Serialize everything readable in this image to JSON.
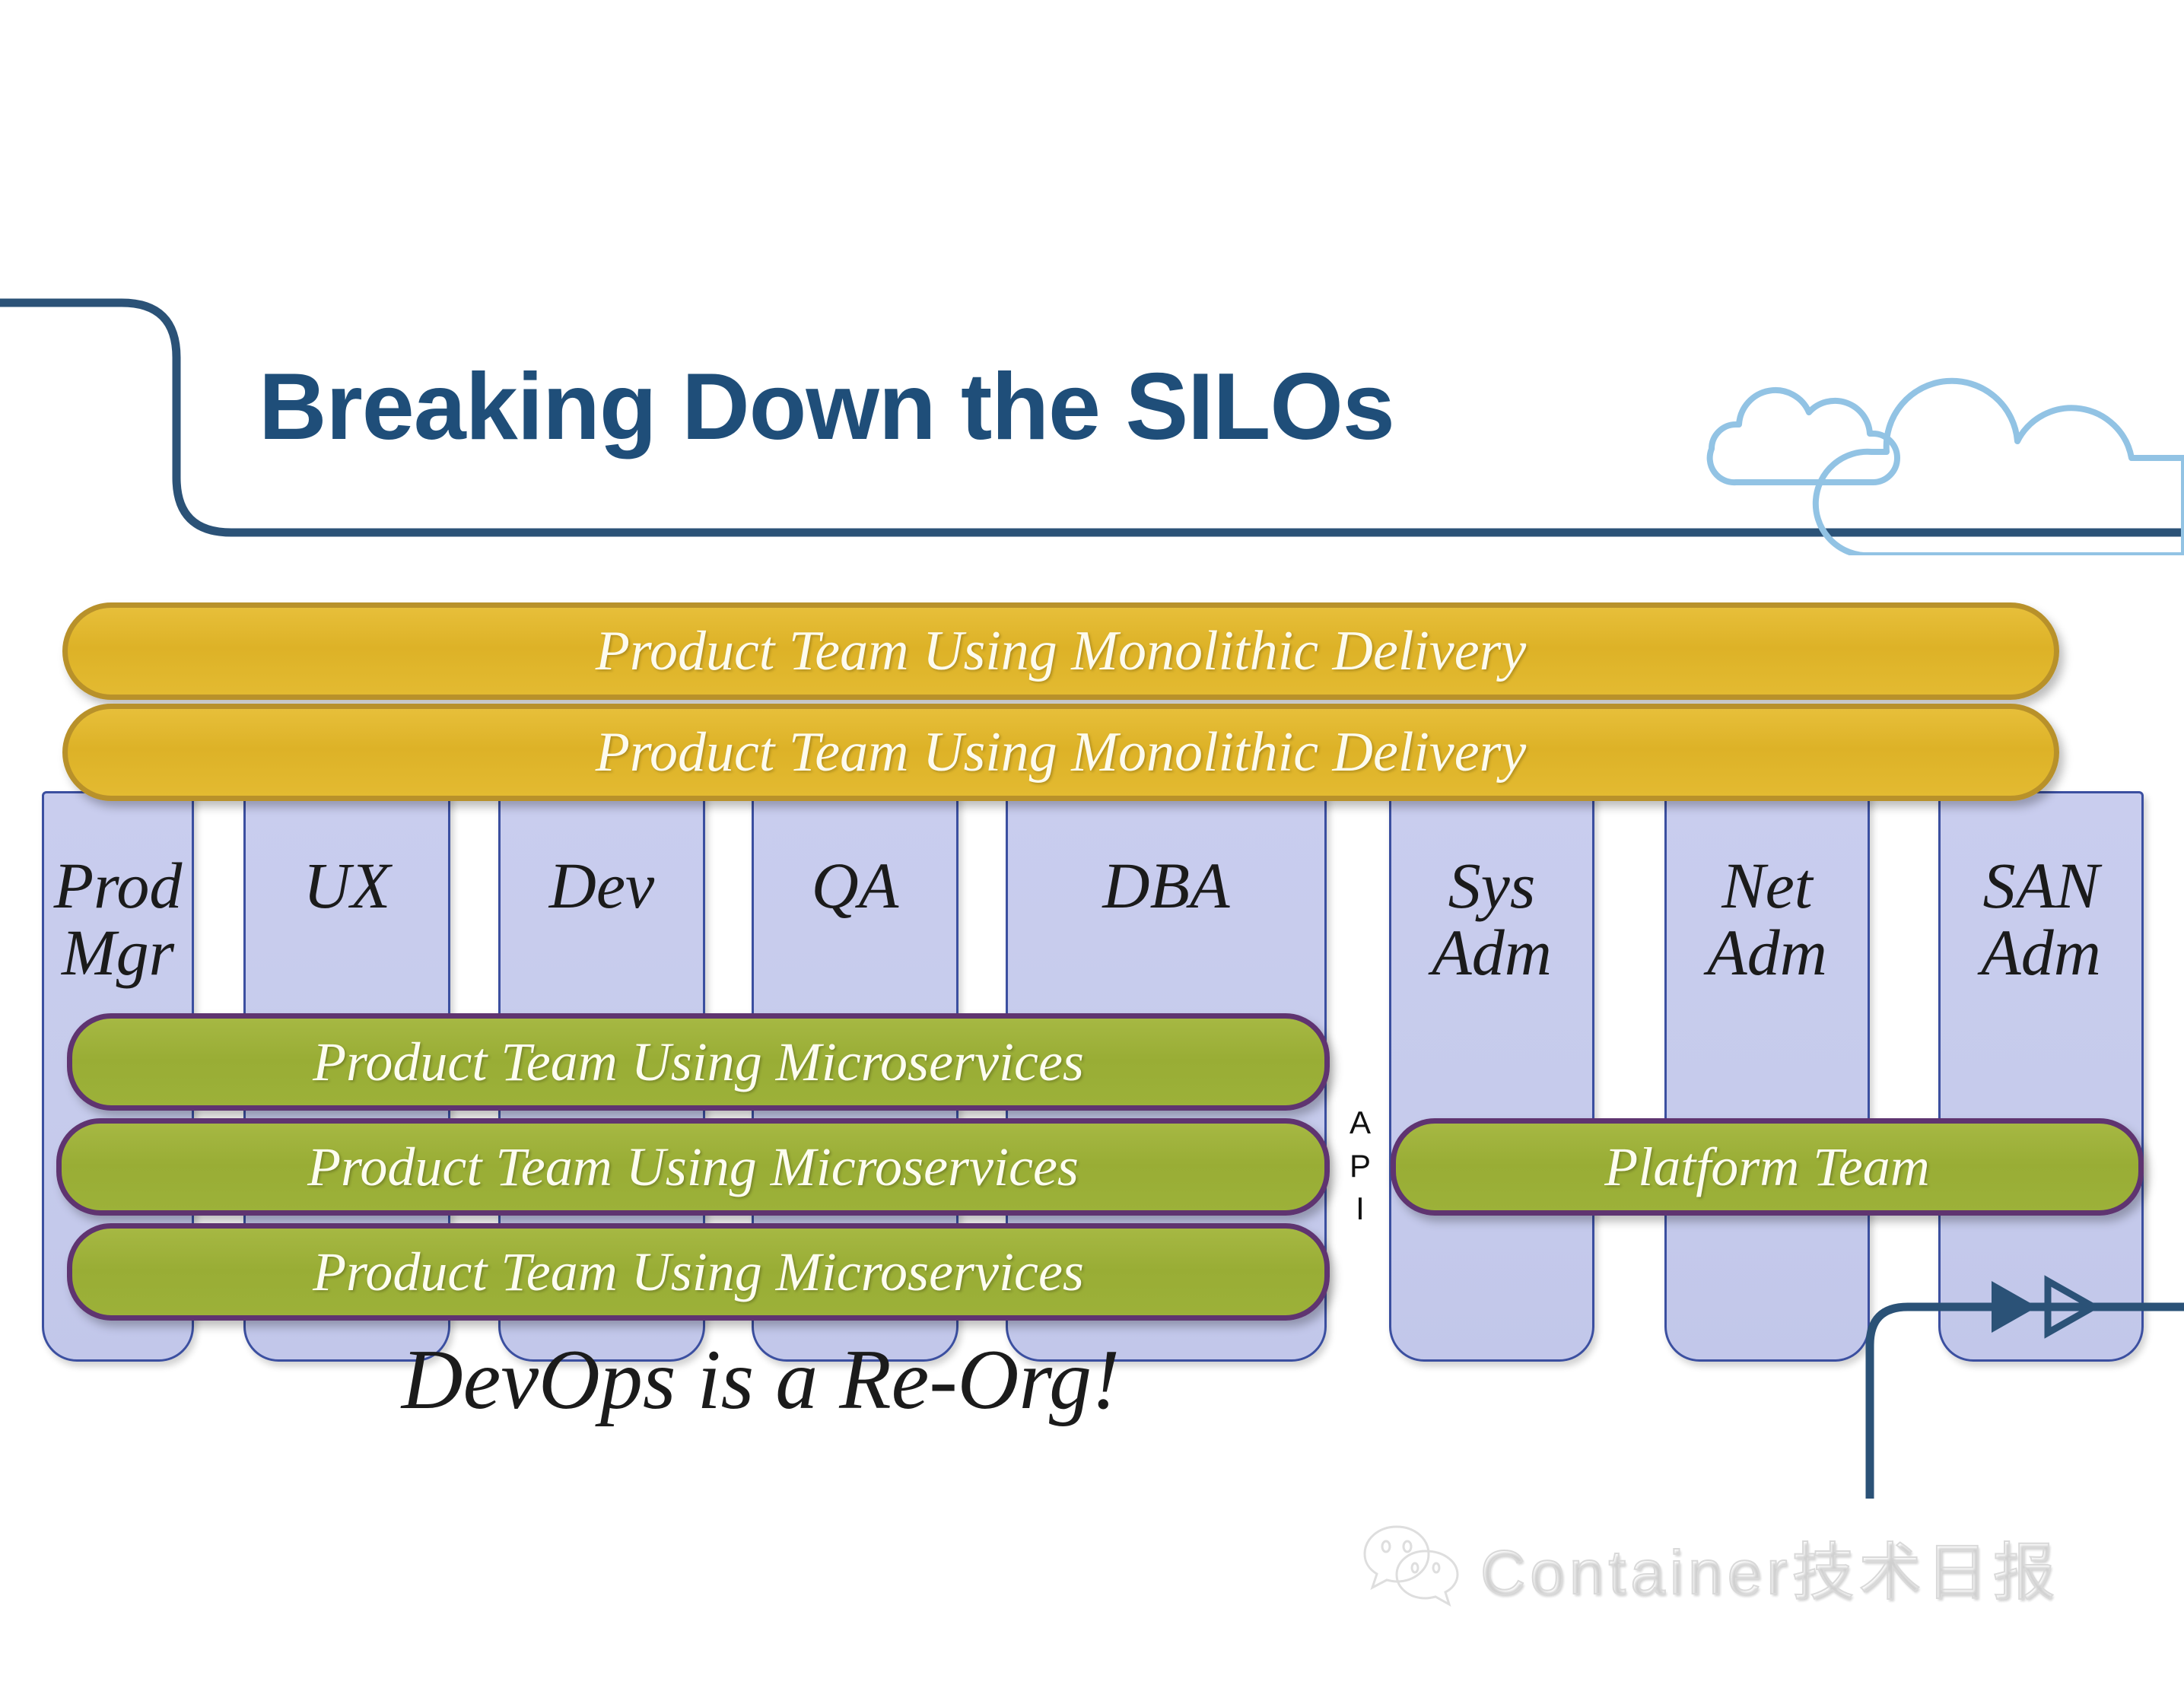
{
  "slide": {
    "title": "Breaking Down the SILOs",
    "tagline": "DevOps is a Re-Org!",
    "background": "#ffffff",
    "title_color": "#1F4E79",
    "accent_line_color": "#2B5277",
    "cloud_color": "#92C3E4"
  },
  "diagram": {
    "api_label": {
      "line1": "A",
      "line2": "P",
      "line3": "I"
    },
    "monolith_bars": [
      {
        "label": "Product Team Using Monolithic Delivery"
      },
      {
        "label": "Product Team Using Monolithic Delivery"
      }
    ],
    "microservice_bars": [
      {
        "label": "Product Team Using Microservices"
      },
      {
        "label": "Product Team Using Microservices"
      },
      {
        "label": "Product Team Using Microservices"
      }
    ],
    "platform_bar": {
      "label": "Platform Team"
    },
    "silos_left": [
      {
        "label": "Prod\nMgr"
      },
      {
        "label": "UX"
      },
      {
        "label": "Dev"
      },
      {
        "label": "QA"
      },
      {
        "label": "DBA"
      }
    ],
    "silos_right": [
      {
        "label": "Sys\nAdm"
      },
      {
        "label": "Net\nAdm"
      },
      {
        "label": "SAN\nAdm"
      }
    ],
    "colors": {
      "silo_fill": "#C6CBEC",
      "silo_border": "#3B4FA0",
      "monolith_fill": "#DDB227",
      "monolith_border": "#B8912A",
      "microservice_fill": "#99AD35",
      "microservice_border": "#5F3470",
      "bar_text": "#FDFBEE",
      "silo_text": "#1B1B1B"
    }
  },
  "watermark": {
    "text": "Container技术日报",
    "icon": "wechat-icon"
  }
}
